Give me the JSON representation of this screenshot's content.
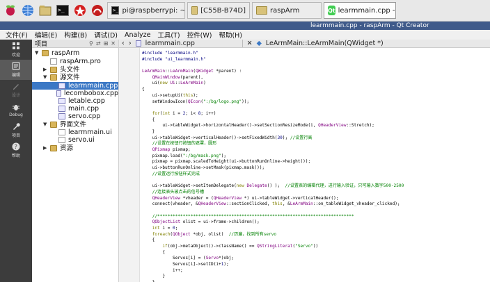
{
  "taskbar": {
    "tasks": [
      {
        "label": "pi@raspberrypi: ~",
        "icon": "terminal-icon"
      },
      {
        "label": "[C55B-B74D]",
        "icon": "folder-icon"
      },
      {
        "label": "raspArm",
        "icon": "folder-icon"
      },
      {
        "label": "learmmain.cpp - rasp...",
        "icon": "qt-creator-icon"
      }
    ]
  },
  "window": {
    "title": "learmmain.cpp - raspArm - Qt Creator"
  },
  "menu": [
    "文件(F)",
    "编辑(E)",
    "构建(B)",
    "调试(D)",
    "Analyze",
    "工具(T)",
    "控件(W)",
    "帮助(H)"
  ],
  "modes": [
    {
      "label": "欢迎",
      "icon": "grid-icon"
    },
    {
      "label": "编辑",
      "icon": "edit-doc-icon"
    },
    {
      "label": "设计",
      "icon": "pen-icon"
    },
    {
      "label": "Debug",
      "icon": "bug-icon"
    },
    {
      "label": "项目",
      "icon": "wrench-icon"
    },
    {
      "label": "帮助",
      "icon": "help-icon"
    }
  ],
  "project": {
    "header": "项目",
    "tree": [
      {
        "label": "raspArm",
        "indent": 0,
        "type": "folder",
        "arrow": "▼"
      },
      {
        "label": "raspArm.pro",
        "indent": 1,
        "type": "file",
        "arrow": ""
      },
      {
        "label": "头文件",
        "indent": 1,
        "type": "folder",
        "arrow": "▶"
      },
      {
        "label": "源文件",
        "indent": 1,
        "type": "folder",
        "arrow": "▼"
      },
      {
        "label": "learmmain.cpp",
        "indent": 2,
        "type": "cpp",
        "arrow": "",
        "selected": true
      },
      {
        "label": "lecombobox.cpp",
        "indent": 2,
        "type": "cpp",
        "arrow": ""
      },
      {
        "label": "letable.cpp",
        "indent": 2,
        "type": "cpp",
        "arrow": ""
      },
      {
        "label": "main.cpp",
        "indent": 2,
        "type": "cpp",
        "arrow": ""
      },
      {
        "label": "servo.cpp",
        "indent": 2,
        "type": "cpp",
        "arrow": ""
      },
      {
        "label": "界面文件",
        "indent": 1,
        "type": "folder",
        "arrow": "▼"
      },
      {
        "label": "learmmain.ui",
        "indent": 2,
        "type": "file",
        "arrow": ""
      },
      {
        "label": "servo.ui",
        "indent": 2,
        "type": "file",
        "arrow": ""
      },
      {
        "label": "资源",
        "indent": 1,
        "type": "folder",
        "arrow": "▶"
      }
    ]
  },
  "editor": {
    "file": "learmmain.cpp",
    "symbol": "LeArmMain::LeArmMain(QWidget *)"
  },
  "code": [
    "#include \"learmmain.h\"",
    "#include \"ui_learmmain.h\"",
    "",
    "LeArmMain::LeArmMain(QWidget *parent) :",
    "    QMainWindow(parent),",
    "    ui(new Ui::LeArmMain)",
    "{",
    "    ui->setupUi(this);",
    "    setWindowIcon(QIcon(\":/bg/logo.png\"));",
    "",
    "    for(int i = 2; i< 8; i++)",
    "    {",
    "        ui->tableWidget->horizontalHeader()->setSectionResizeMode(i, QHeaderView::Stretch);",
    "    }",
    "    ui->tableWidget->verticalHeader()->setFixedWidth(30); //设置行高",
    "    //设置在按钮行按钮的遮罩，圆形",
    "    QPixmap pixmap;",
    "    pixmap.load(\":/bg/mask.png\");",
    "    pixmap = pixmap.scaledToHeight(ui->buttonRunOnline->height());",
    "    ui->buttonRunOnline->setMask(pixmap.mask());",
    "    //设置运行按钮样式完成",
    "",
    "    ui->tableWidget->setItemDelegate(new Delegate() );  //设置表的编辑代理，进行输入验证，只可输入数字500-2500",
    "    //连接表头被点击的信号槽",
    "    QHeaderView *vheader = (QHeaderView *) ui->tableWidget->verticalHeader();",
    "    connect(vheader, &QHeaderView::sectionClicked, this, &LeArmMain::on_tableWidget_vheader_clicked);",
    "",
    "    //*****************************************************************************",
    "    QObjectList olist = ui->frame->children();",
    "    int i = 0;",
    "    foreach(QObject *obj, olist)  //历遍，找到所有servo",
    "    {",
    "        if(obj->metaObject()->className() == QStringLiteral(\"Servo\"))",
    "        {",
    "            Servos[i] = (Servo*)obj;",
    "            Servos[i]->setID(i+1);",
    "            i++;",
    "        }",
    "    }",
    "    //*****************************************************************************"
  ]
}
